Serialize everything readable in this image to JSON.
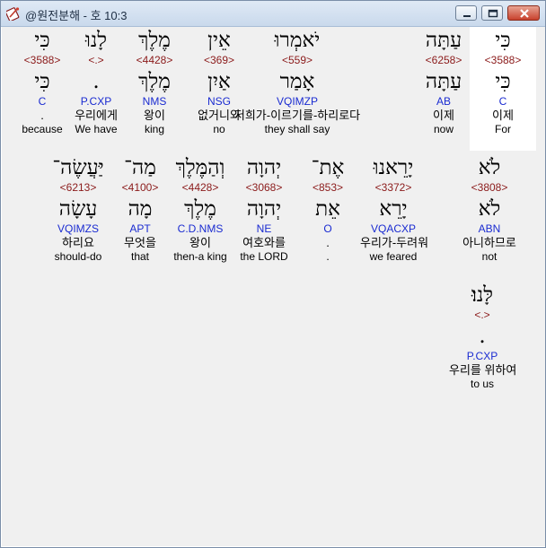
{
  "window": {
    "title": "@원전분해 - 호 10:3"
  },
  "words": [
    {
      "heb": "כִּי",
      "strong": "<3588>",
      "lemma": "כִּי",
      "morph": "C",
      "kor": "이제",
      "eng": "For",
      "highlight": true
    },
    {
      "heb": "עַתָּה",
      "strong": "<6258>",
      "lemma": "עַתָּה",
      "morph": "AB",
      "kor": "이제",
      "eng": "now"
    },
    {
      "heb": "יֹאמְרוּ",
      "strong": "<559>",
      "lemma": "אָמַר",
      "morph": "VQIMZP",
      "kor": "저희가-이르기를-하리로다",
      "eng": "they shall say"
    },
    {
      "heb": "אֵין",
      "strong": "<369>",
      "lemma": "אַיִן",
      "morph": "NSG",
      "kor": "없거니와",
      "eng": "no"
    },
    {
      "heb": "מֶלֶךְ",
      "strong": "<4428>",
      "lemma": "מֶלֶךְ",
      "morph": "NMS",
      "kor": "왕이",
      "eng": "king"
    },
    {
      "heb": "לָנוּ",
      "strong": "<.>",
      "lemma": ".",
      "morph": "P.CXP",
      "kor": "우리에게",
      "eng": "We have"
    },
    {
      "heb": "כִּי",
      "strong": "<3588>",
      "lemma": "כִּי",
      "morph": "C",
      "kor": ".",
      "eng": "because"
    },
    {
      "heb": "לֹא",
      "strong": "<3808>",
      "lemma": "לֹא",
      "morph": "ABN",
      "kor": "아니하므로",
      "eng": "not"
    },
    {
      "heb": "יָרֵאנוּ",
      "strong": "<3372>",
      "lemma": "יָרֵא",
      "morph": "VQACXP",
      "kor": "우리가-두려워",
      "eng": "we feared"
    },
    {
      "heb": "אֶת־",
      "strong": "<853>",
      "lemma": "אֵת",
      "morph": "O",
      "kor": ".",
      "eng": "."
    },
    {
      "heb": "יְהוָה",
      "strong": "<3068>",
      "lemma": "יְהוָה",
      "morph": "NE",
      "kor": "여호와를",
      "eng": "the LORD"
    },
    {
      "heb": "וְהַמֶּלֶךְ",
      "strong": "<4428>",
      "lemma": "מֶלֶךְ",
      "morph": "C.D.NMS",
      "kor": "왕이",
      "eng": "then-a king"
    },
    {
      "heb": "מַה־",
      "strong": "<4100>",
      "lemma": "מָה",
      "morph": "APT",
      "kor": "무엇을",
      "eng": "that"
    },
    {
      "heb": "יַּעֲשֶׂה־",
      "strong": "<6213>",
      "lemma": "עָשָׂה",
      "morph": "VQIMZS",
      "kor": "하리요",
      "eng": "should-do"
    },
    {
      "heb": "לָּנוּ׃",
      "strong": "<.>",
      "lemma": ".",
      "morph": "P.CXP",
      "kor": "우리를 위하여",
      "eng": "to us"
    }
  ],
  "icons": {
    "app": "bible-app-icon",
    "minimize": "minimize-icon",
    "maximize": "maximize-icon",
    "close": "close-icon"
  }
}
